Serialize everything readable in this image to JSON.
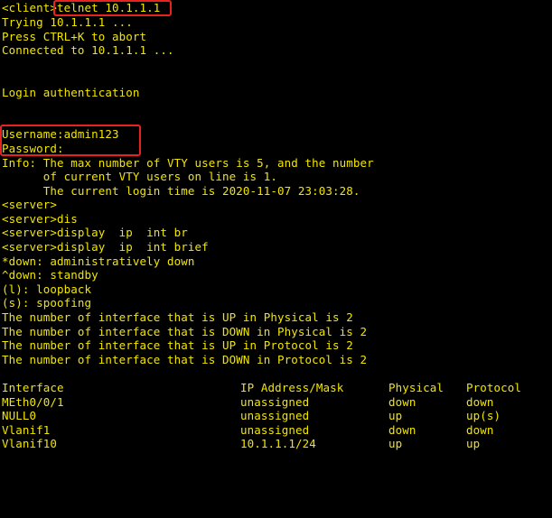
{
  "session": {
    "prompt_client": "<client>",
    "command_telnet": "telnet 10.1.1.1",
    "trying": "Trying 10.1.1.1 ...",
    "escape_hint": "Press CTRL+K to abort",
    "connected": "Connected to 10.1.1.1 ...",
    "login_banner": "Login authentication",
    "username_line": "Username:admin123",
    "password_line": "Password:",
    "info_line1": "Info: The max number of VTY users is 5, and the number",
    "info_line2": "      of current VTY users on line is 1.",
    "info_line3": "      The current login time is 2020-11-07 23:03:28.",
    "prompt_server1": "<server>",
    "prompt_server_dis": "<server>dis",
    "prompt_server_display_br": "<server>display  ip  int br",
    "prompt_server_display_brief": "<server>display  ip  int brief",
    "legend_down": "*down: administratively down",
    "legend_standby": "^down: standby",
    "legend_loopback": "(l): loopback",
    "legend_spoofing": "(s): spoofing",
    "summary_up_physical": "The number of interface that is UP in Physical is 2",
    "summary_down_physical": "The number of interface that is DOWN in Physical is 2",
    "summary_up_protocol": "The number of interface that is UP in Protocol is 2",
    "summary_down_protocol": "The number of interface that is DOWN in Protocol is 2"
  },
  "interface_table": {
    "headers": [
      "Interface",
      "IP Address/Mask",
      "Physical",
      "Protocol"
    ],
    "rows": [
      [
        "MEth0/0/1",
        "unassigned",
        "down",
        "down"
      ],
      [
        "NULL0",
        "unassigned",
        "up",
        "up(s)"
      ],
      [
        "Vlanif1",
        "unassigned",
        "down",
        "down"
      ],
      [
        "Vlanif10",
        "10.1.1.1/24",
        "up",
        "up"
      ]
    ]
  },
  "colors": {
    "background": "#000000",
    "text": "#f2e600",
    "highlight_box": "#e8221e"
  }
}
